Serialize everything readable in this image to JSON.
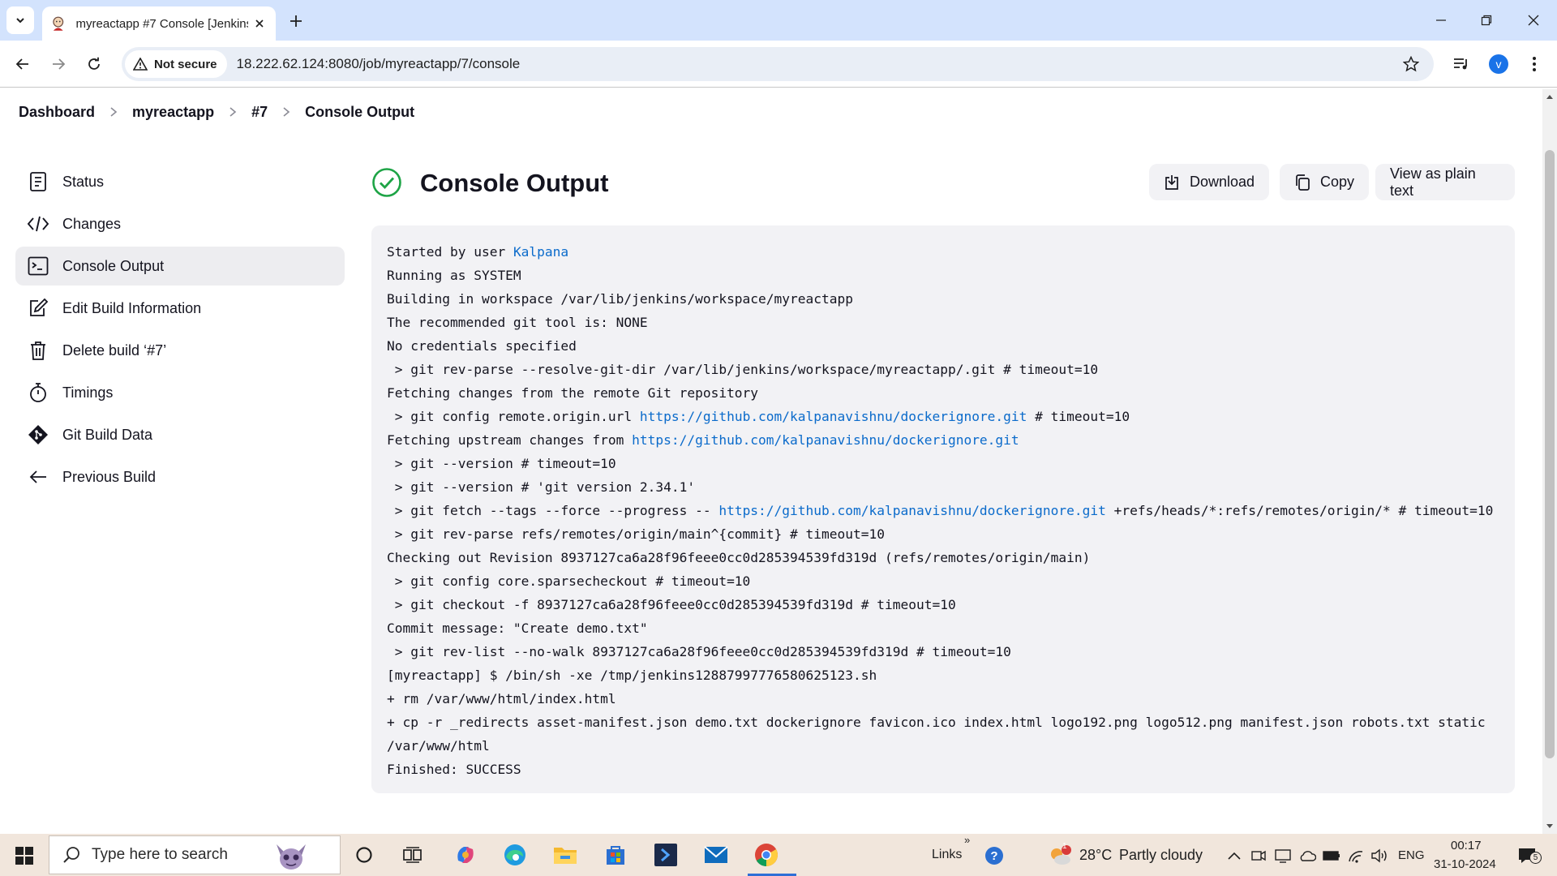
{
  "browser": {
    "tab": {
      "title": "myreactapp #7 Console [Jenkins]"
    },
    "security_label": "Not secure",
    "url": "18.222.62.124:8080/job/myreactapp/7/console",
    "profile_initial": "v"
  },
  "breadcrumb": [
    "Dashboard",
    "myreactapp",
    "#7",
    "Console Output"
  ],
  "sidebar": {
    "items": [
      {
        "label": "Status",
        "icon": "notepad-icon",
        "active": false
      },
      {
        "label": "Changes",
        "icon": "code-icon",
        "active": false
      },
      {
        "label": "Console Output",
        "icon": "terminal-icon",
        "active": true
      },
      {
        "label": "Edit Build Information",
        "icon": "edit-icon",
        "active": false
      },
      {
        "label": "Delete build ‘#7’",
        "icon": "trash-icon",
        "active": false
      },
      {
        "label": "Timings",
        "icon": "stopwatch-icon",
        "active": false
      },
      {
        "label": "Git Build Data",
        "icon": "git-icon",
        "active": false
      },
      {
        "label": "Previous Build",
        "icon": "arrow-left-icon",
        "active": false
      }
    ]
  },
  "main": {
    "title": "Console Output",
    "status": "success",
    "buttons": {
      "download": "Download",
      "copy": "Copy",
      "plain": "View as plain text"
    }
  },
  "console": {
    "lines": [
      [
        {
          "t": "Started by user "
        },
        {
          "t": "Kalpana",
          "link": true
        }
      ],
      [
        {
          "t": "Running as SYSTEM"
        }
      ],
      [
        {
          "t": "Building in workspace /var/lib/jenkins/workspace/myreactapp"
        }
      ],
      [
        {
          "t": "The recommended git tool is: NONE"
        }
      ],
      [
        {
          "t": "No credentials specified"
        }
      ],
      [
        {
          "t": " > git rev-parse --resolve-git-dir /var/lib/jenkins/workspace/myreactapp/.git # timeout=10"
        }
      ],
      [
        {
          "t": "Fetching changes from the remote Git repository"
        }
      ],
      [
        {
          "t": " > git config remote.origin.url "
        },
        {
          "t": "https://github.com/kalpanavishnu/dockerignore.git",
          "link": true
        },
        {
          "t": " # timeout=10"
        }
      ],
      [
        {
          "t": "Fetching upstream changes from "
        },
        {
          "t": "https://github.com/kalpanavishnu/dockerignore.git",
          "link": true
        }
      ],
      [
        {
          "t": " > git --version # timeout=10"
        }
      ],
      [
        {
          "t": " > git --version # 'git version 2.34.1'"
        }
      ],
      [
        {
          "t": " > git fetch --tags --force --progress -- "
        },
        {
          "t": "https://github.com/kalpanavishnu/dockerignore.git",
          "link": true
        },
        {
          "t": " +refs/heads/*:refs/remotes/origin/* # timeout=10"
        }
      ],
      [
        {
          "t": " > git rev-parse refs/remotes/origin/main^{commit} # timeout=10"
        }
      ],
      [
        {
          "t": "Checking out Revision 8937127ca6a28f96feee0cc0d285394539fd319d (refs/remotes/origin/main)"
        }
      ],
      [
        {
          "t": " > git config core.sparsecheckout # timeout=10"
        }
      ],
      [
        {
          "t": " > git checkout -f 8937127ca6a28f96feee0cc0d285394539fd319d # timeout=10"
        }
      ],
      [
        {
          "t": "Commit message: \"Create demo.txt\""
        }
      ],
      [
        {
          "t": " > git rev-list --no-walk 8937127ca6a28f96feee0cc0d285394539fd319d # timeout=10"
        }
      ],
      [
        {
          "t": "[myreactapp] $ /bin/sh -xe /tmp/jenkins12887997776580625123.sh"
        }
      ],
      [
        {
          "t": "+ rm /var/www/html/index.html"
        }
      ],
      [
        {
          "t": "+ cp -r _redirects asset-manifest.json demo.txt dockerignore favicon.ico index.html logo192.png logo512.png manifest.json robots.txt static"
        }
      ],
      [
        {
          "t": "/var/www/html"
        }
      ],
      [
        {
          "t": "Finished: SUCCESS"
        }
      ]
    ]
  },
  "taskbar": {
    "search_placeholder": "Type here to search",
    "links_label": "Links",
    "weather": {
      "temp": "28°C",
      "condition": "Partly cloudy",
      "badge": "1"
    },
    "language": "ENG",
    "time": "00:17",
    "date": "31-10-2024",
    "notification_count": "5"
  },
  "colors": {
    "link": "#0b6bcb",
    "success": "#1ea446",
    "accent": "#1a73e8"
  }
}
